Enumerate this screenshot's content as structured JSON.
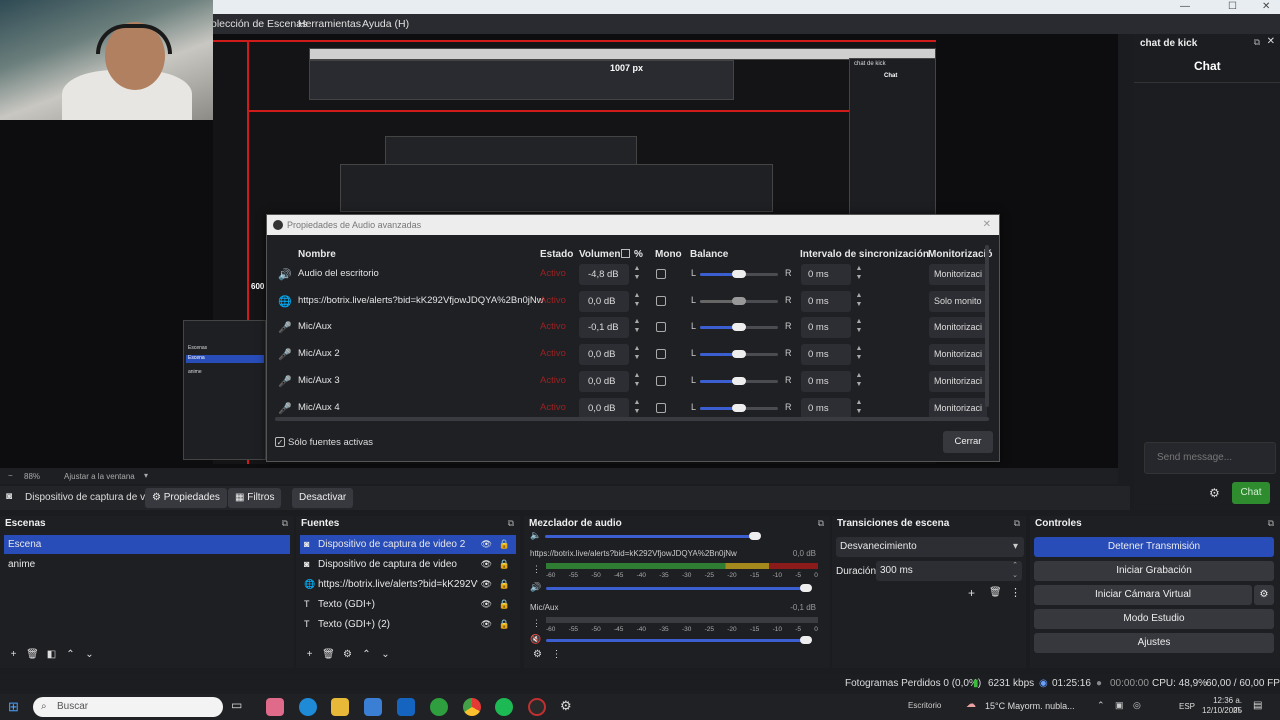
{
  "window": {
    "menu": [
      "olección de Escenas",
      "Herramientas",
      "Ayuda (H)"
    ],
    "controls": [
      "—",
      "☐",
      "✕"
    ]
  },
  "preview": {
    "nested_size_label": "1007 px",
    "nested_chat_title": "chat de kick",
    "nested_chat_heading": "Chat",
    "left_label": "600",
    "nested_scenes": [
      "Escenas",
      "Escena",
      "anime"
    ]
  },
  "canvas_bar": {
    "zoom": "88%",
    "fit": "Ajustar a la ventana"
  },
  "context_bar": {
    "source": "Dispositivo de captura de v",
    "properties": "Propiedades",
    "filters": "Filtros",
    "deactivate": "Desactivar"
  },
  "dialog": {
    "title": "Propiedades de Audio avanzadas",
    "headers": {
      "name": "Nombre",
      "status": "Estado",
      "volume": "Volumen",
      "percent": "%",
      "mono": "Mono",
      "balance": "Balance",
      "sync": "Intervalo de sincronización",
      "monitor": "Monitorizació"
    },
    "rows": [
      {
        "icon": "speaker-icon",
        "glyph": "🔊",
        "name": "Audio del escritorio",
        "status": "Activo",
        "volume": "-4,8 dB",
        "balance_l": "L",
        "balance_r": "R",
        "balance": 0.5,
        "sync": "0 ms",
        "monitor": "Monitorizaci"
      },
      {
        "icon": "globe-icon",
        "glyph": "🌐",
        "name": "https://botrix.live/alerts?bid=kK292VfjowJDQYA%2Bn0jNw",
        "status": "Activo",
        "volume": "0,0 dB",
        "balance_l": "L",
        "balance_r": "R",
        "balance": 0.5,
        "sync": "0 ms",
        "monitor": "Solo monito"
      },
      {
        "icon": "mic-icon",
        "glyph": "🎤",
        "name": "Mic/Aux",
        "status": "Activo",
        "volume": "-0,1 dB",
        "balance_l": "L",
        "balance_r": "R",
        "balance": 0.5,
        "sync": "0 ms",
        "monitor": "Monitorizaci"
      },
      {
        "icon": "mic-icon",
        "glyph": "🎤",
        "name": "Mic/Aux 2",
        "status": "Activo",
        "volume": "0,0 dB",
        "balance_l": "L",
        "balance_r": "R",
        "balance": 0.5,
        "sync": "0 ms",
        "monitor": "Monitorizaci"
      },
      {
        "icon": "mic-icon",
        "glyph": "🎤",
        "name": "Mic/Aux 3",
        "status": "Activo",
        "volume": "0,0 dB",
        "balance_l": "L",
        "balance_r": "R",
        "balance": 0.5,
        "sync": "0 ms",
        "monitor": "Monitorizaci"
      },
      {
        "icon": "mic-icon",
        "glyph": "🎤",
        "name": "Mic/Aux 4",
        "status": "Activo",
        "volume": "0,0 dB",
        "balance_l": "L",
        "balance_r": "R",
        "balance": 0.5,
        "sync": "0 ms",
        "monitor": "Monitorizaci"
      }
    ],
    "only_active": "Sólo fuentes activas",
    "close": "Cerrar"
  },
  "scenes": {
    "title": "Escenas",
    "items": [
      "Escena",
      "anime"
    ],
    "selected": 0
  },
  "sources": {
    "title": "Fuentes",
    "items": [
      {
        "icon": "camera-icon",
        "label": "Dispositivo de captura de video 2"
      },
      {
        "icon": "camera-icon",
        "label": "Dispositivo de captura de video"
      },
      {
        "icon": "globe-icon",
        "label": "https://botrix.live/alerts?bid=kK292VfjowJ"
      },
      {
        "icon": "text-icon",
        "label": "Texto (GDI+)"
      },
      {
        "icon": "text-icon",
        "label": "Texto (GDI+) (2)"
      }
    ],
    "selected": 0
  },
  "mixer": {
    "title": "Mezclador de audio",
    "channels": [
      {
        "name": "https://botrix.live/alerts?bid=kK292VfjowJDQYA%2Bn0jNw",
        "db": "0,0 dB"
      },
      {
        "name": "Mic/Aux",
        "db": "-0,1 dB"
      }
    ],
    "ticks": [
      "-60",
      "-55",
      "-50",
      "-45",
      "-40",
      "-35",
      "-30",
      "-25",
      "-20",
      "-15",
      "-10",
      "-5",
      "0"
    ]
  },
  "transitions": {
    "title": "Transiciones de escena",
    "type": "Desvanecimiento",
    "duration_label": "Duración",
    "duration": "300 ms"
  },
  "controls": {
    "title": "Controles",
    "buttons": [
      "Detener Transmisión",
      "Iniciar Grabación",
      "Iniciar Cámara Virtual",
      "Modo Estudio",
      "Ajustes"
    ]
  },
  "chat": {
    "title": "chat de kick",
    "heading": "Chat",
    "placeholder": "Send message...",
    "send": "Chat"
  },
  "status": {
    "dropped": "Fotogramas Perdidos 0 (0,0%)",
    "bitrate": "6231 kbps",
    "live_time": "01:25:16",
    "rec_time": "00:00:00",
    "cpu": "CPU: 48,9%",
    "fps": "60,00 / 60,00 FPS"
  },
  "taskbar": {
    "search": "Buscar",
    "desktop": "Escritorio",
    "weather": "15°C  Mayorm. nubla...",
    "lang": "ESP",
    "time": "12:36 a. m.",
    "date": "12/10/2025"
  },
  "colors": {
    "accent": "#284cb8",
    "live_red": "#d01b1b",
    "chat_send": "#2e8b2e"
  }
}
